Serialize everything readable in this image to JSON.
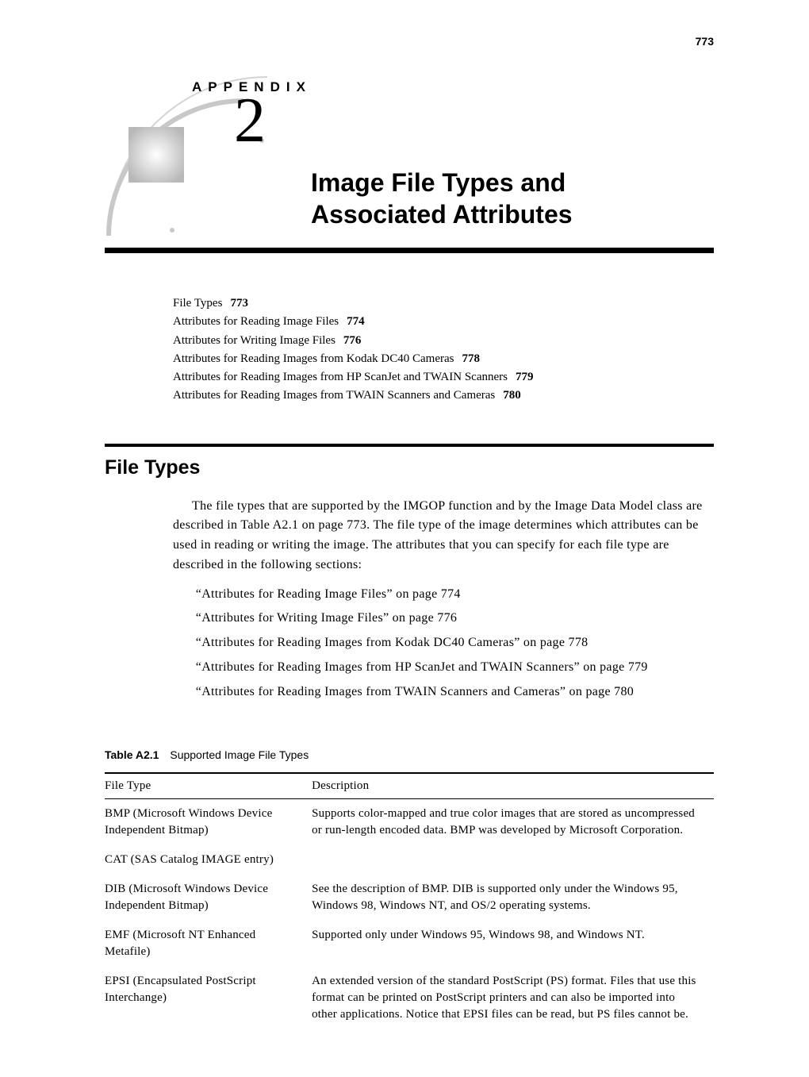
{
  "page_number": "773",
  "header": {
    "appendix_label": "APPENDIX",
    "appendix_number": "2",
    "title_line1": "Image File Types and",
    "title_line2": "Associated Attributes"
  },
  "toc": [
    {
      "title": "File Types",
      "page": "773"
    },
    {
      "title": "Attributes for Reading Image Files",
      "page": "774"
    },
    {
      "title": "Attributes for Writing Image Files",
      "page": "776"
    },
    {
      "title": "Attributes for Reading Images from Kodak DC40 Cameras",
      "page": "778"
    },
    {
      "title": "Attributes for Reading Images from HP ScanJet and TWAIN Scanners",
      "page": "779"
    },
    {
      "title": "Attributes for Reading Images from TWAIN Scanners and Cameras",
      "page": "780"
    }
  ],
  "section": {
    "heading": "File Types",
    "paragraph": "The file types that are supported by the IMGOP function and by the Image Data Model class are described in Table A2.1 on page 773. The file type of the image determines which attributes can be used in reading or writing the image. The attributes that you can specify for each file type are described in the following sections:",
    "refs": [
      "“Attributes for Reading Image Files” on page 774",
      "“Attributes for Writing Image Files” on page 776",
      "“Attributes for Reading Images from Kodak DC40 Cameras” on page 778",
      "“Attributes for Reading Images from HP ScanJet and TWAIN Scanners” on page 779",
      "“Attributes for Reading Images from TWAIN Scanners and Cameras” on page 780"
    ]
  },
  "table": {
    "caption_label": "Table A2.1",
    "caption_text": "Supported Image File Types",
    "headers": {
      "col1": "File Type",
      "col2": "Description"
    },
    "rows": [
      {
        "type": "BMP (Microsoft Windows Device Independent Bitmap)",
        "desc": "Supports color-mapped and true color images that are stored as uncompressed or run-length encoded data. BMP was developed by Microsoft Corporation."
      },
      {
        "type": "CAT (SAS Catalog IMAGE entry)",
        "desc": ""
      },
      {
        "type": "DIB (Microsoft Windows Device Independent Bitmap)",
        "desc": "See the description of BMP. DIB is supported only under the Windows 95, Windows 98, Windows NT, and OS/2 operating systems."
      },
      {
        "type": "EMF (Microsoft NT Enhanced Metafile)",
        "desc": "Supported only under Windows 95, Windows 98, and Windows NT."
      },
      {
        "type": "EPSI (Encapsulated PostScript Interchange)",
        "desc": "An extended version of the standard PostScript (PS) format. Files that use this format can be printed on PostScript printers and can also be imported into other applications. Notice that EPSI files can be read, but PS files cannot be."
      }
    ]
  }
}
